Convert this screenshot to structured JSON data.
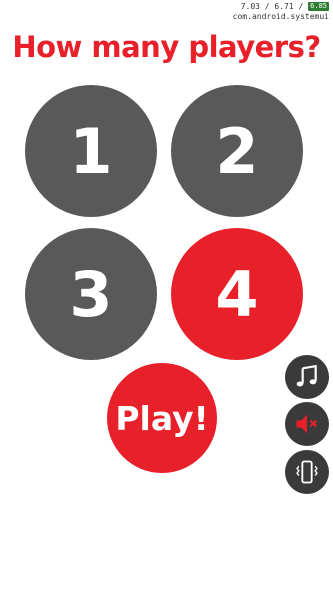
{
  "status": {
    "memory_text": "7.03 / 6.71 /",
    "memory_badge": "6.85",
    "process_name": "com.android.systemui"
  },
  "title": "How many players?",
  "player_options": [
    {
      "label": "1",
      "selected": false
    },
    {
      "label": "2",
      "selected": false
    },
    {
      "label": "3",
      "selected": false
    },
    {
      "label": "4",
      "selected": true
    }
  ],
  "play_label": "Play!",
  "side_controls": {
    "music": {
      "icon": "music-note-icon"
    },
    "sound": {
      "icon": "speaker-muted-icon"
    },
    "vibrate": {
      "icon": "vibrate-icon"
    }
  },
  "colors": {
    "accent": "#e8202a",
    "option_default": "#595959",
    "control_bg": "#3a3a3a",
    "background": "#ffffff"
  }
}
